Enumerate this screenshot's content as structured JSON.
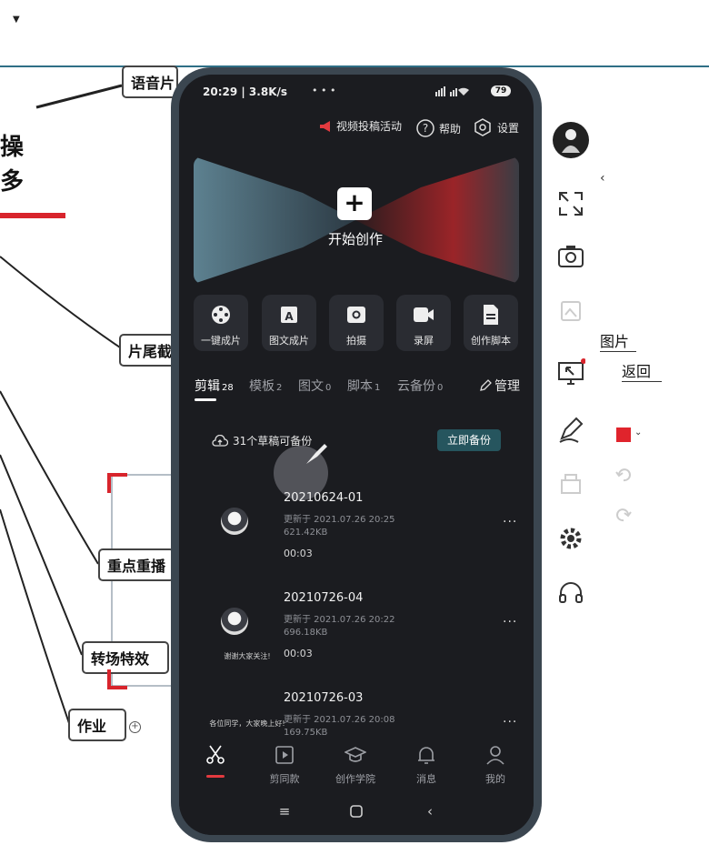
{
  "mindmap": {
    "partial_heading_line1": "操",
    "partial_heading_line2": "多",
    "nodes": {
      "yuyin": "语音片",
      "pianwei": "片尾截",
      "zhongdian": "重点重播",
      "zhuanchang": "转场特效",
      "zuoye": "作业"
    },
    "right_labels": {
      "tupian": "图片",
      "fanhui": "返回"
    }
  },
  "phone": {
    "status": {
      "time": "20:29 | 3.8K/s",
      "battery": "79"
    },
    "top_actions": {
      "contribute": "视频投稿活动",
      "help": "帮助",
      "settings": "设置"
    },
    "hero": {
      "start_label": "开始创作"
    },
    "quick_actions": [
      {
        "label": "一键成片",
        "icon": "film-reel-icon"
      },
      {
        "label": "图文成片",
        "icon": "image-text-icon"
      },
      {
        "label": "拍摄",
        "icon": "camera-icon"
      },
      {
        "label": "录屏",
        "icon": "screen-record-icon"
      },
      {
        "label": "创作脚本",
        "icon": "script-icon"
      }
    ],
    "tabs": [
      {
        "label": "剪辑",
        "count": "28"
      },
      {
        "label": "模板",
        "count": "2"
      },
      {
        "label": "图文",
        "count": "0"
      },
      {
        "label": "脚本",
        "count": "1"
      },
      {
        "label": "云备份",
        "count": "0"
      }
    ],
    "manage_label": "管理",
    "backup": {
      "text": "31个草稿可备份",
      "button": "立即备份"
    },
    "drafts": [
      {
        "title": "20210624-01",
        "updated": "更新于 2021.07.26 20:25",
        "size": "621.42KB",
        "duration": "00:03",
        "caption": ""
      },
      {
        "title": "20210726-04",
        "updated": "更新于 2021.07.26 20:22",
        "size": "696.18KB",
        "duration": "00:03",
        "caption": "谢谢大家关注!"
      },
      {
        "title": "20210726-03",
        "updated": "更新于 2021.07.26 20:08",
        "size": "169.75KB",
        "duration": "",
        "caption": "各位同学，大家晚上好!"
      }
    ],
    "bottom_nav": [
      {
        "label": "",
        "icon": "scissors-icon"
      },
      {
        "label": "剪同款",
        "icon": "template-icon"
      },
      {
        "label": "创作学院",
        "icon": "graduation-cap-icon"
      },
      {
        "label": "消息",
        "icon": "bell-icon"
      },
      {
        "label": "我的",
        "icon": "profile-icon"
      }
    ]
  },
  "colors": {
    "accent_red": "#d8242c",
    "phone_bg": "#1b1c20",
    "backup_btn": "#26555e"
  }
}
